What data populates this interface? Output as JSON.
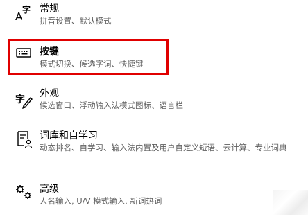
{
  "menu": {
    "items": [
      {
        "id": "general",
        "icon": "font-size-icon",
        "title": "常规",
        "description": "拼音设置、默认模式"
      },
      {
        "id": "keys",
        "icon": "keyboard-icon",
        "title": "按键",
        "description": "模式切换、候选字词、快捷键"
      },
      {
        "id": "appearance",
        "icon": "pen-character-icon",
        "title": "外观",
        "description": "候选窗口、浮动输入法模式图标、语言栏"
      },
      {
        "id": "lexicon",
        "icon": "book-user-icon",
        "title": "词库和自学习",
        "description": "动态排名、自学习、输入法内置及用户自定义短语、云计算、专业词典"
      },
      {
        "id": "advanced",
        "icon": "gears-icon",
        "title": "高级",
        "description": "人名输入, U/V 模式输入, 新词热词"
      }
    ]
  },
  "colors": {
    "highlight_border": "#e00000",
    "title_text": "#000000",
    "description_text": "#5f5f5f"
  }
}
